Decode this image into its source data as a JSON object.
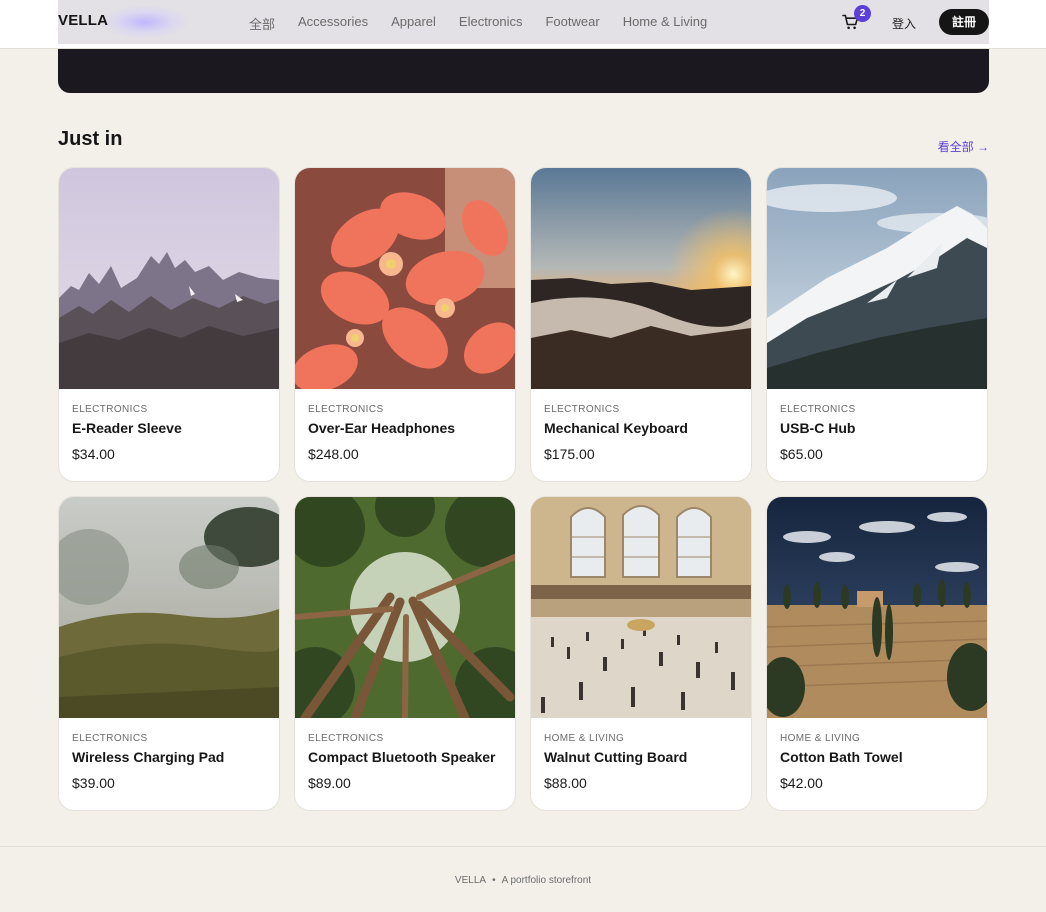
{
  "header": {
    "logo": "VELLA",
    "nav": [
      "全部",
      "Accessories",
      "Apparel",
      "Electronics",
      "Footwear",
      "Home & Living"
    ],
    "cart_count": "2",
    "login_label": "登入",
    "signup_label": "註冊",
    "icons": {
      "cart": "shopping-cart-icon"
    }
  },
  "section": {
    "title": "Just in",
    "view_all": "看全部 →"
  },
  "products": [
    {
      "category": "ELECTRONICS",
      "name": "E-Reader Sleeve",
      "price": "$34.00",
      "image": "rocky-mountain-peaks-at-dusk"
    },
    {
      "category": "ELECTRONICS",
      "name": "Over-Ear Headphones",
      "price": "$248.00",
      "image": "coral-pink-flowers-closeup"
    },
    {
      "category": "ELECTRONICS",
      "name": "Mechanical Keyboard",
      "price": "$175.00",
      "image": "sunrise-over-misty-hills"
    },
    {
      "category": "ELECTRONICS",
      "name": "USB-C Hub",
      "price": "$65.00",
      "image": "snowy-mountain-ridge"
    },
    {
      "category": "ELECTRONICS",
      "name": "Wireless Charging Pad",
      "price": "$39.00",
      "image": "foggy-green-meadow"
    },
    {
      "category": "ELECTRONICS",
      "name": "Compact Bluetooth Speaker",
      "price": "$89.00",
      "image": "redwood-forest-looking-up"
    },
    {
      "category": "HOME & LIVING",
      "name": "Walnut Cutting Board",
      "price": "$88.00",
      "image": "grand-central-station-hall"
    },
    {
      "category": "HOME & LIVING",
      "name": "Cotton Bath Towel",
      "price": "$42.00",
      "image": "tuscan-farmhouse-cypress-trees"
    }
  ],
  "footer": {
    "brand": "VELLA",
    "separator": "•",
    "tagline": "A portfolio storefront"
  },
  "colors": {
    "accent": "#5b3fd8",
    "page_bg": "#f3f0ea",
    "hero_bg": "#1b1820",
    "button_dark": "#151515"
  }
}
